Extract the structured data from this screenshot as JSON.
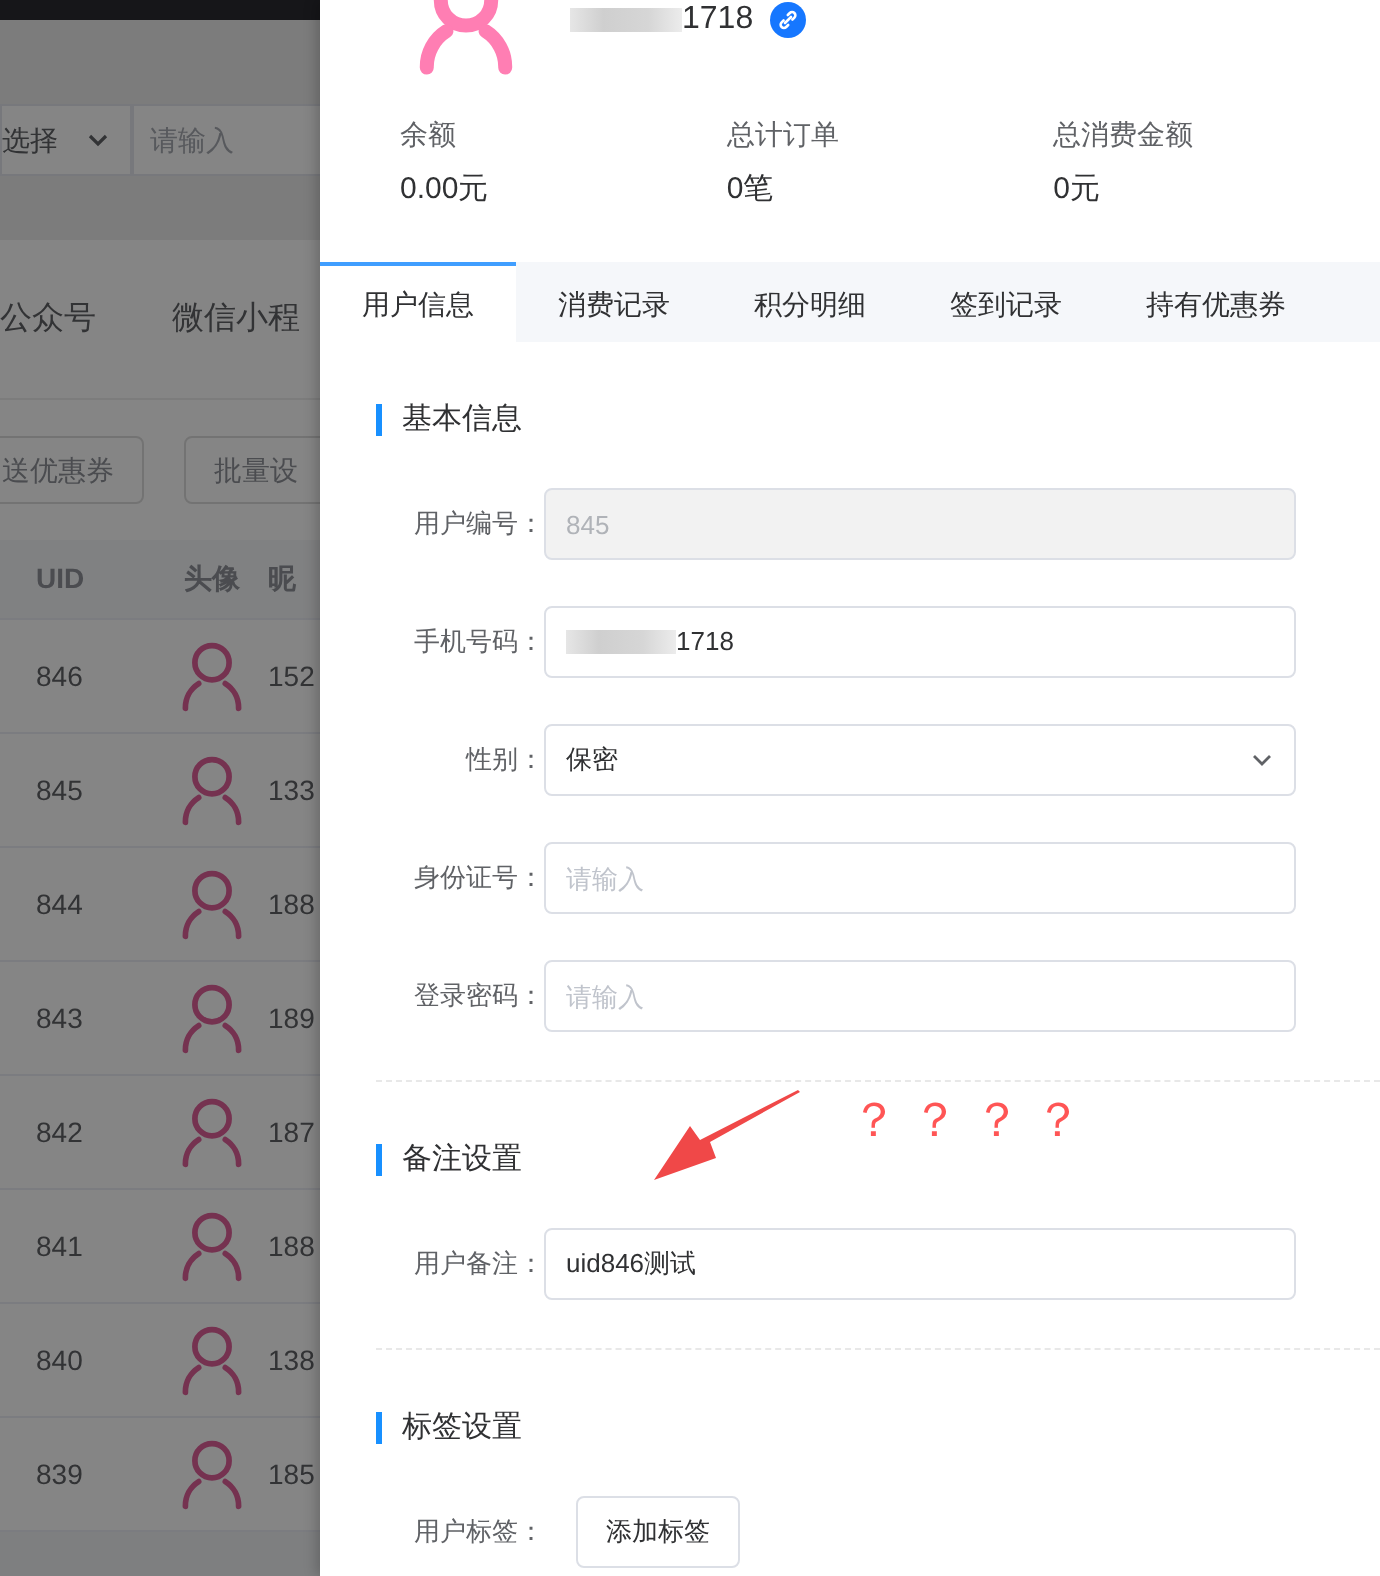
{
  "background_page": {
    "filter": {
      "select_value": "选择",
      "input_placeholder": "请输入"
    },
    "tabs": [
      "公众号",
      "微信小程"
    ],
    "buttons": [
      "送优惠券",
      "批量设"
    ],
    "table": {
      "columns": [
        "UID",
        "头像",
        "昵"
      ],
      "rows": [
        {
          "uid": "846",
          "column_3": "152"
        },
        {
          "uid": "845",
          "column_3": "133"
        },
        {
          "uid": "844",
          "column_3": "188"
        },
        {
          "uid": "843",
          "column_3": "189"
        },
        {
          "uid": "842",
          "column_3": "187"
        },
        {
          "uid": "841",
          "column_3": "188"
        },
        {
          "uid": "840",
          "column_3": "138"
        },
        {
          "uid": "839",
          "column_3": "185"
        }
      ]
    }
  },
  "drawer": {
    "user": {
      "name": "1718"
    },
    "stats": [
      {
        "label": "余额",
        "value": "0.00元"
      },
      {
        "label": "总计订单",
        "value": "0笔"
      },
      {
        "label": "总消费金额",
        "value": "0元"
      }
    ],
    "tabs": [
      {
        "label": "用户信息",
        "selected": true
      },
      {
        "label": "消费记录",
        "selected": false
      },
      {
        "label": "积分明细",
        "selected": false
      },
      {
        "label": "签到记录",
        "selected": false
      },
      {
        "label": "持有优惠券",
        "selected": false
      }
    ],
    "sections": [
      {
        "title": "基本信息",
        "fields": [
          {
            "label": "用户编号：",
            "kind": "input",
            "value": "845",
            "disabled": true
          },
          {
            "label": "手机号码：",
            "kind": "masked",
            "value": "1718",
            "disabled": false
          },
          {
            "label": "性别：",
            "kind": "select",
            "value": "保密",
            "disabled": false
          },
          {
            "label": "身份证号：",
            "kind": "input",
            "placeholder": "请输入",
            "disabled": false
          },
          {
            "label": "登录密码：",
            "kind": "input",
            "placeholder": "请输入",
            "disabled": false
          }
        ]
      },
      {
        "title": "备注设置",
        "fields": [
          {
            "label": "用户备注：",
            "kind": "input",
            "value": "uid846测试",
            "disabled": false
          }
        ]
      },
      {
        "title": "标签设置",
        "fields": [
          {
            "label": "用户标签：",
            "kind": "button",
            "value": "添加标签"
          }
        ]
      }
    ]
  },
  "annotation": {
    "text": "？ ？ ？ ？"
  }
}
